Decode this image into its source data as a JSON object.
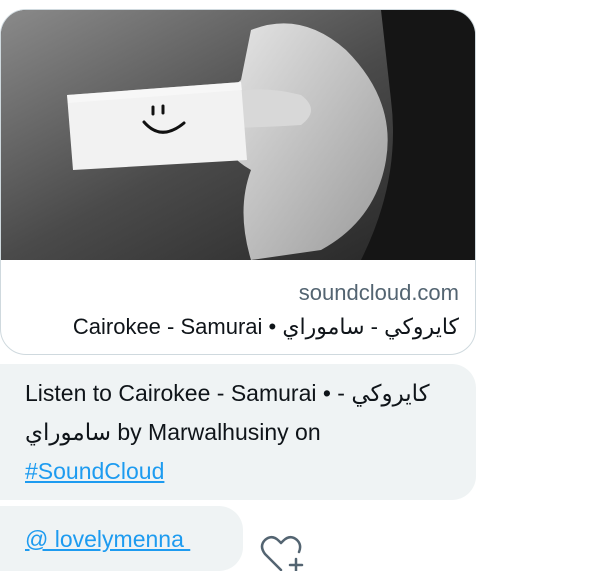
{
  "link_card": {
    "domain": "soundcloud.com",
    "title": "Cairokee - Samurai • كايروكي - ساموراي"
  },
  "message": {
    "text_before": "Listen to Cairokee - Samurai • كايروكي - ساموراي by Marwalhusiny on ",
    "hashtag": "#SoundCloud"
  },
  "mention_message": {
    "mention": "@ lovelymenna "
  },
  "icons": {
    "react": "heart-plus-icon"
  }
}
